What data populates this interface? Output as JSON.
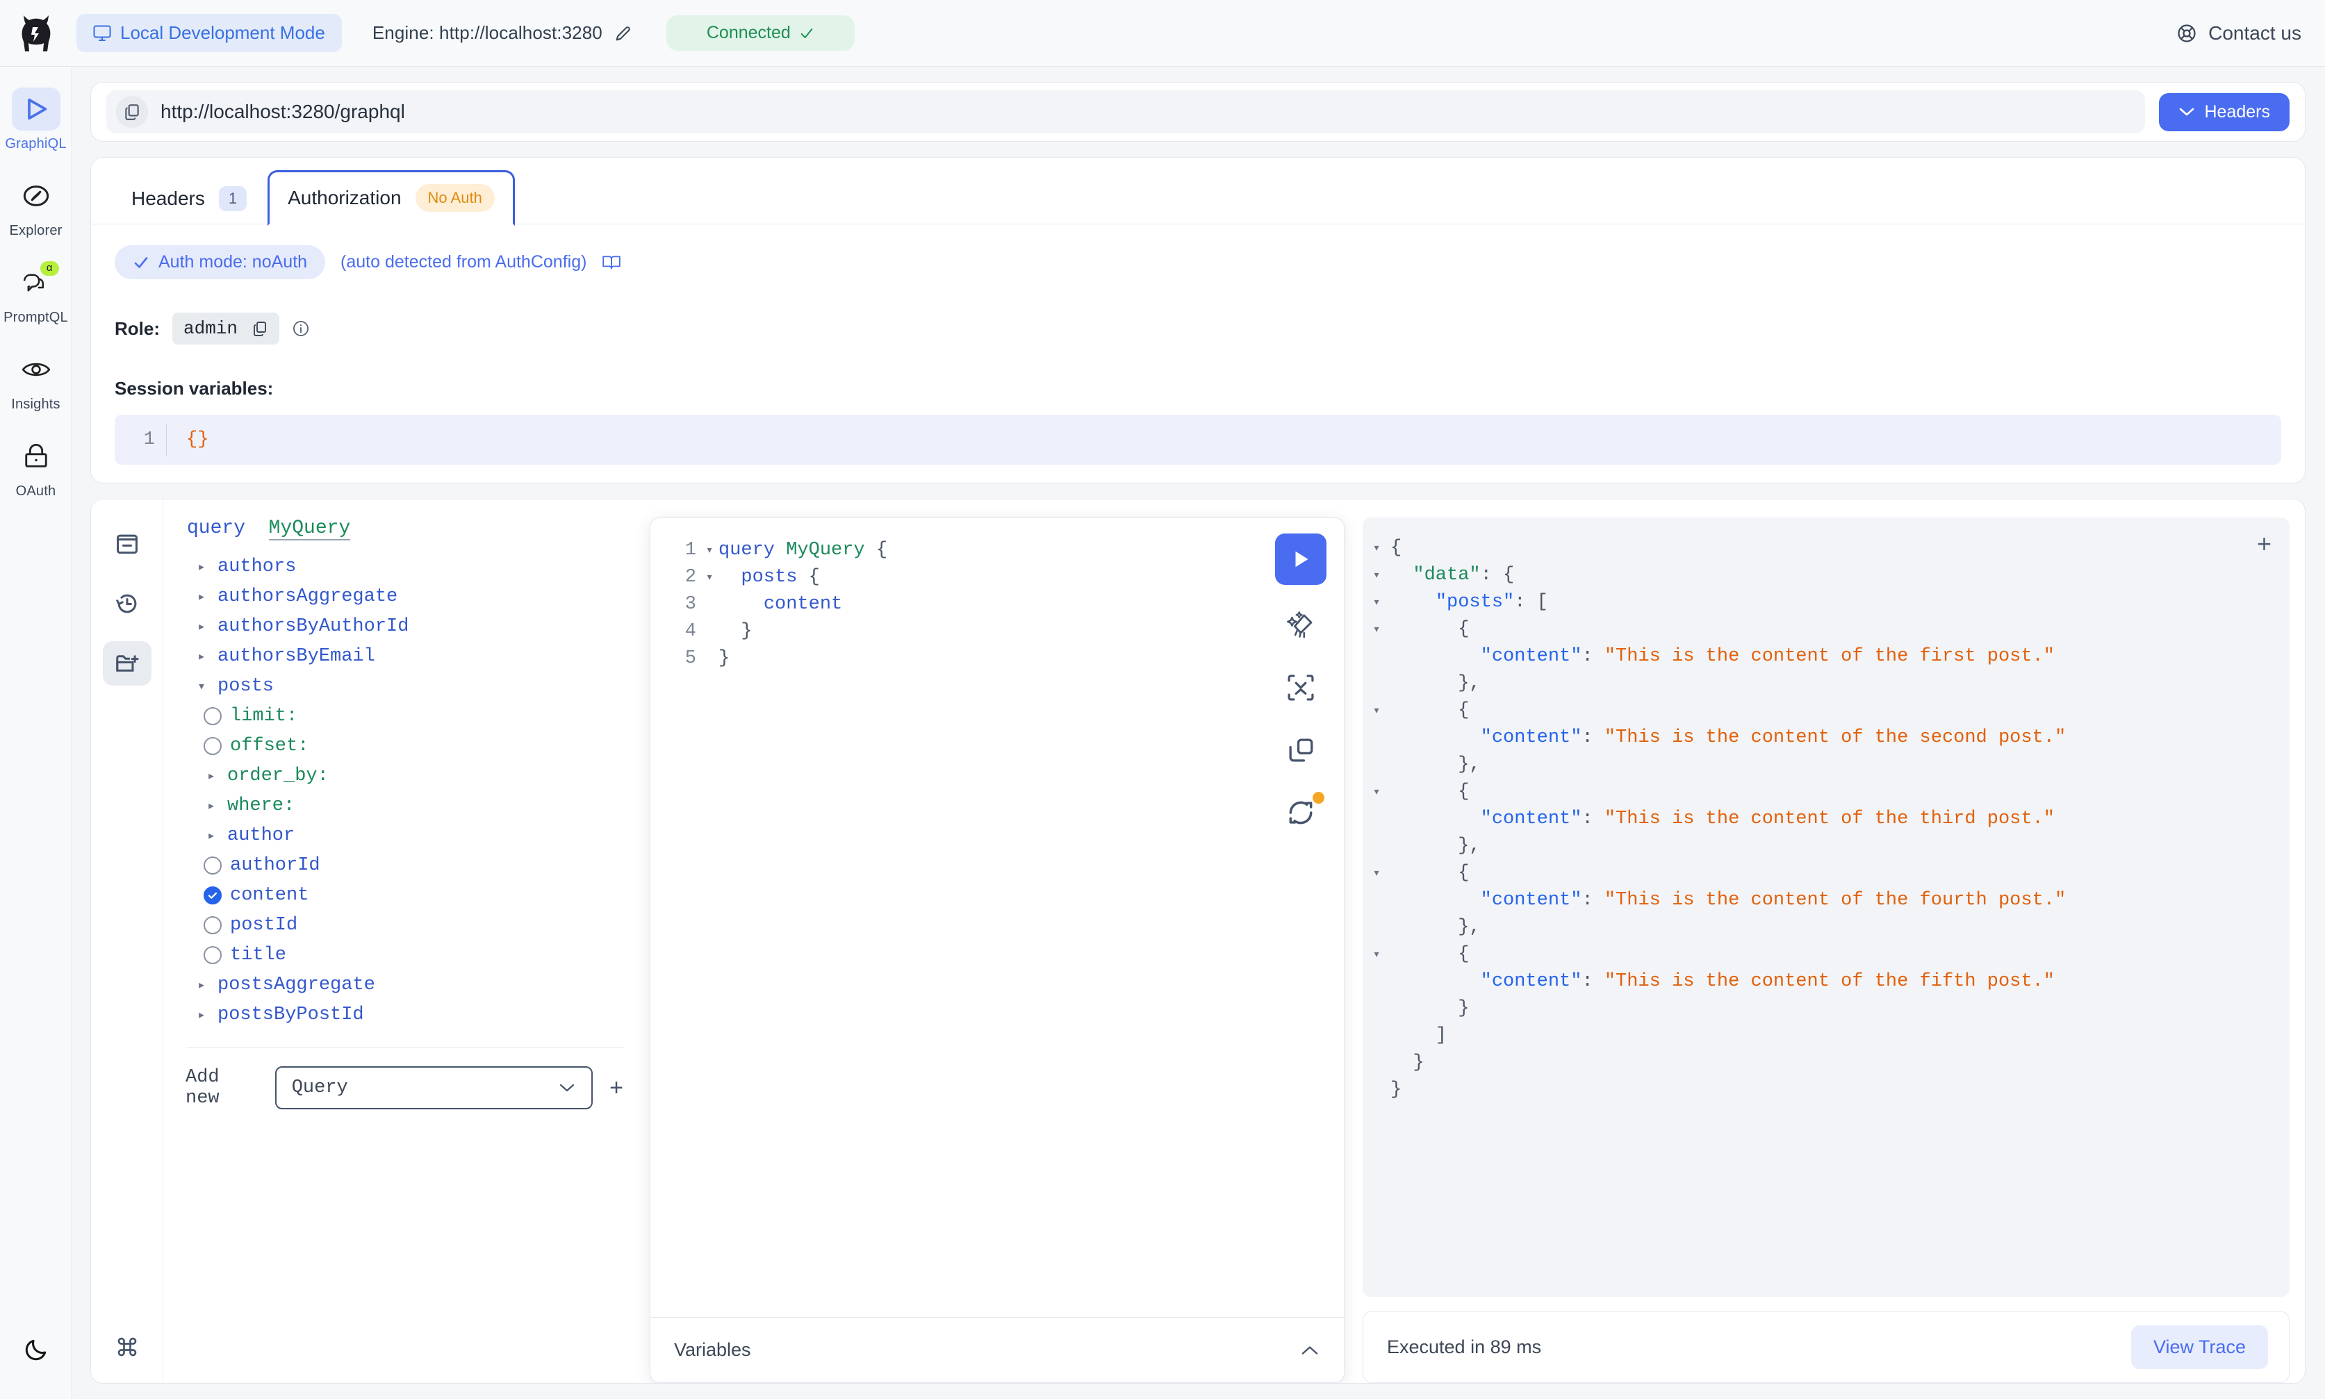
{
  "topbar": {
    "logo_name": "hasura-logo",
    "mode_label": "Local Development Mode",
    "engine_label": "Engine: http://localhost:3280",
    "connection_label": "Connected",
    "contact_label": "Contact us"
  },
  "rail": {
    "items": [
      {
        "label": "GraphiQL",
        "icon": "play-icon",
        "active": true,
        "badge": ""
      },
      {
        "label": "Explorer",
        "icon": "compass-icon",
        "active": false,
        "badge": ""
      },
      {
        "label": "PromptQL",
        "icon": "chat-icon",
        "active": false,
        "badge": "α"
      },
      {
        "label": "Insights",
        "icon": "eye-icon",
        "active": false,
        "badge": ""
      },
      {
        "label": "OAuth",
        "icon": "lock-icon",
        "active": false,
        "badge": ""
      }
    ],
    "theme_toggle": "moon-icon"
  },
  "urlbar": {
    "url": "http://localhost:3280/graphql",
    "headers_button": "Headers"
  },
  "auth": {
    "tabs": [
      {
        "label": "Headers",
        "count": "1",
        "active": false
      },
      {
        "label": "Authorization",
        "badge": "No Auth",
        "active": true
      }
    ],
    "mode_pill": "Auth mode: noAuth",
    "mode_note": "(auto detected from AuthConfig)",
    "role_label": "Role:",
    "role_value": "admin",
    "session_label": "Session variables:",
    "session_line_no": "1",
    "session_value": "{}"
  },
  "gql_rail": {
    "buttons": [
      {
        "name": "docs-icon",
        "active": false
      },
      {
        "name": "history-icon",
        "active": false
      },
      {
        "name": "explorer-folder-icon",
        "active": true
      }
    ],
    "shortcut_icon": "command-icon"
  },
  "explorer": {
    "operation_keyword": "query",
    "operation_name": "MyQuery",
    "nodes": [
      {
        "label": "authors",
        "kind": "field",
        "control": "caret",
        "indent": 0,
        "expanded": false
      },
      {
        "label": "authorsAggregate",
        "kind": "field",
        "control": "caret",
        "indent": 0,
        "expanded": false
      },
      {
        "label": "authorsByAuthorId",
        "kind": "field",
        "control": "caret",
        "indent": 0,
        "expanded": false
      },
      {
        "label": "authorsByEmail",
        "kind": "field",
        "control": "caret",
        "indent": 0,
        "expanded": false
      },
      {
        "label": "posts",
        "kind": "field",
        "control": "caret",
        "indent": 0,
        "expanded": true
      },
      {
        "label": "limit:",
        "kind": "arg",
        "control": "radio",
        "indent": 1,
        "checked": false
      },
      {
        "label": "offset:",
        "kind": "arg",
        "control": "radio",
        "indent": 1,
        "checked": false
      },
      {
        "label": "order_by:",
        "kind": "arg",
        "control": "caret",
        "indent": 1,
        "expanded": false
      },
      {
        "label": "where:",
        "kind": "arg",
        "control": "caret",
        "indent": 1,
        "expanded": false
      },
      {
        "label": "author",
        "kind": "field",
        "control": "caret",
        "indent": 1,
        "expanded": false
      },
      {
        "label": "authorId",
        "kind": "field",
        "control": "radio",
        "indent": 1,
        "checked": false
      },
      {
        "label": "content",
        "kind": "field",
        "control": "radio",
        "indent": 1,
        "checked": true
      },
      {
        "label": "postId",
        "kind": "field",
        "control": "radio",
        "indent": 1,
        "checked": false
      },
      {
        "label": "title",
        "kind": "field",
        "control": "radio",
        "indent": 1,
        "checked": false
      },
      {
        "label": "postsAggregate",
        "kind": "field",
        "control": "caret",
        "indent": 0,
        "expanded": false
      },
      {
        "label": "postsByPostId",
        "kind": "field",
        "control": "caret",
        "indent": 0,
        "expanded": false
      }
    ],
    "add_new_label": "Add new",
    "add_new_value": "Query",
    "add_new_plus": "+"
  },
  "editor": {
    "lines": [
      {
        "no": "1",
        "fold": "▾",
        "segments": [
          {
            "t": "query ",
            "c": "c-kw"
          },
          {
            "t": "MyQuery",
            "c": "c-op"
          },
          {
            "t": " {",
            "c": "c-punc"
          }
        ]
      },
      {
        "no": "2",
        "fold": "▾",
        "segments": [
          {
            "t": "  ",
            "c": "c-punc"
          },
          {
            "t": "posts",
            "c": "c-field"
          },
          {
            "t": " {",
            "c": "c-punc"
          }
        ]
      },
      {
        "no": "3",
        "fold": "",
        "segments": [
          {
            "t": "    ",
            "c": "c-punc"
          },
          {
            "t": "content",
            "c": "c-field"
          }
        ]
      },
      {
        "no": "4",
        "fold": "",
        "segments": [
          {
            "t": "  }",
            "c": "c-punc"
          }
        ]
      },
      {
        "no": "5",
        "fold": "",
        "segments": [
          {
            "t": "}",
            "c": "c-punc"
          }
        ]
      }
    ],
    "tools": [
      {
        "name": "execute-query-button",
        "icon": "play-icon"
      },
      {
        "name": "prettify-button",
        "icon": "broom-icon"
      },
      {
        "name": "merge-fragments-button",
        "icon": "collapse-icon"
      },
      {
        "name": "copy-query-button",
        "icon": "copy-icon"
      },
      {
        "name": "refetch-schema-button",
        "icon": "refresh-icon",
        "dot": true
      }
    ],
    "variables_label": "Variables",
    "variables_chevron": "chevron-up-icon"
  },
  "response": {
    "add_tab_icon": "+",
    "lines": [
      {
        "fold": "▾",
        "segments": [
          {
            "t": "{",
            "c": "j-punc"
          }
        ]
      },
      {
        "fold": "▾",
        "segments": [
          {
            "t": "  ",
            "c": "j-punc"
          },
          {
            "t": "\"data\"",
            "c": "j-key-d"
          },
          {
            "t": ": {",
            "c": "j-punc"
          }
        ]
      },
      {
        "fold": "▾",
        "segments": [
          {
            "t": "    ",
            "c": "j-punc"
          },
          {
            "t": "\"posts\"",
            "c": "j-key"
          },
          {
            "t": ": [",
            "c": "j-punc"
          }
        ]
      },
      {
        "fold": "▾",
        "segments": [
          {
            "t": "      {",
            "c": "j-punc"
          }
        ]
      },
      {
        "fold": "",
        "segments": [
          {
            "t": "        ",
            "c": "j-punc"
          },
          {
            "t": "\"content\"",
            "c": "j-key"
          },
          {
            "t": ": ",
            "c": "j-punc"
          },
          {
            "t": "\"This is the content of the first post.\"",
            "c": "j-str"
          }
        ]
      },
      {
        "fold": "",
        "segments": [
          {
            "t": "      },",
            "c": "j-punc"
          }
        ]
      },
      {
        "fold": "▾",
        "segments": [
          {
            "t": "      {",
            "c": "j-punc"
          }
        ]
      },
      {
        "fold": "",
        "segments": [
          {
            "t": "        ",
            "c": "j-punc"
          },
          {
            "t": "\"content\"",
            "c": "j-key"
          },
          {
            "t": ": ",
            "c": "j-punc"
          },
          {
            "t": "\"This is the content of the second post.\"",
            "c": "j-str"
          }
        ]
      },
      {
        "fold": "",
        "segments": [
          {
            "t": "      },",
            "c": "j-punc"
          }
        ]
      },
      {
        "fold": "▾",
        "segments": [
          {
            "t": "      {",
            "c": "j-punc"
          }
        ]
      },
      {
        "fold": "",
        "segments": [
          {
            "t": "        ",
            "c": "j-punc"
          },
          {
            "t": "\"content\"",
            "c": "j-key"
          },
          {
            "t": ": ",
            "c": "j-punc"
          },
          {
            "t": "\"This is the content of the third post.\"",
            "c": "j-str"
          }
        ]
      },
      {
        "fold": "",
        "segments": [
          {
            "t": "      },",
            "c": "j-punc"
          }
        ]
      },
      {
        "fold": "▾",
        "segments": [
          {
            "t": "      {",
            "c": "j-punc"
          }
        ]
      },
      {
        "fold": "",
        "segments": [
          {
            "t": "        ",
            "c": "j-punc"
          },
          {
            "t": "\"content\"",
            "c": "j-key"
          },
          {
            "t": ": ",
            "c": "j-punc"
          },
          {
            "t": "\"This is the content of the fourth post.\"",
            "c": "j-str"
          }
        ]
      },
      {
        "fold": "",
        "segments": [
          {
            "t": "      },",
            "c": "j-punc"
          }
        ]
      },
      {
        "fold": "▾",
        "segments": [
          {
            "t": "      {",
            "c": "j-punc"
          }
        ]
      },
      {
        "fold": "",
        "segments": [
          {
            "t": "        ",
            "c": "j-punc"
          },
          {
            "t": "\"content\"",
            "c": "j-key"
          },
          {
            "t": ": ",
            "c": "j-punc"
          },
          {
            "t": "\"This is the content of the fifth post.\"",
            "c": "j-str"
          }
        ]
      },
      {
        "fold": "",
        "segments": [
          {
            "t": "      }",
            "c": "j-punc"
          }
        ]
      },
      {
        "fold": "",
        "segments": [
          {
            "t": "    ]",
            "c": "j-punc"
          }
        ]
      },
      {
        "fold": "",
        "segments": [
          {
            "t": "  }",
            "c": "j-punc"
          }
        ]
      },
      {
        "fold": "",
        "segments": [
          {
            "t": "}",
            "c": "j-punc"
          }
        ]
      }
    ],
    "executed_text": "Executed in 89 ms",
    "view_trace": "View Trace"
  },
  "colors": {
    "accent": "#4a6cf0",
    "success": "#1e8f52",
    "warning": "#e08a10",
    "string": "#e2600a",
    "field": "#3358cc",
    "alpha_badge": "#b6f03c"
  }
}
